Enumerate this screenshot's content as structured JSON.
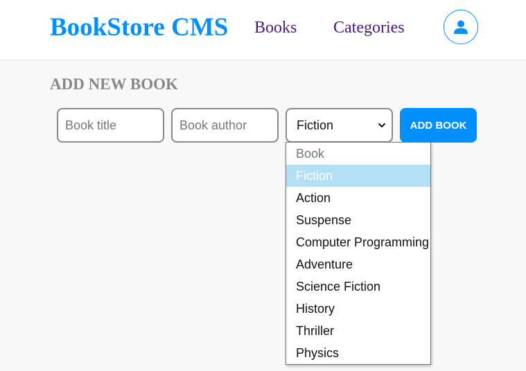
{
  "header": {
    "logo": "BookStore CMS",
    "nav": [
      "Books",
      "Categories"
    ],
    "avatar_icon": "user-icon"
  },
  "form": {
    "section_title": "ADD NEW BOOK",
    "title_placeholder": "Book title",
    "author_placeholder": "Book author",
    "category_selected": "Fiction",
    "add_button_label": "ADD BOOK"
  },
  "dropdown": {
    "options": [
      {
        "label": "Book",
        "state": "disabled"
      },
      {
        "label": "Fiction",
        "state": "selected"
      },
      {
        "label": "Action",
        "state": "normal"
      },
      {
        "label": "Suspense",
        "state": "normal"
      },
      {
        "label": "Computer Programming",
        "state": "normal"
      },
      {
        "label": "Adventure",
        "state": "normal"
      },
      {
        "label": "Science Fiction",
        "state": "normal"
      },
      {
        "label": "History",
        "state": "normal"
      },
      {
        "label": "Thriller",
        "state": "normal"
      },
      {
        "label": "Physics",
        "state": "normal"
      }
    ]
  },
  "colors": {
    "brand": "#0290ff",
    "nav_link": "#4a1a7a",
    "highlight": "#b3e0f5"
  }
}
